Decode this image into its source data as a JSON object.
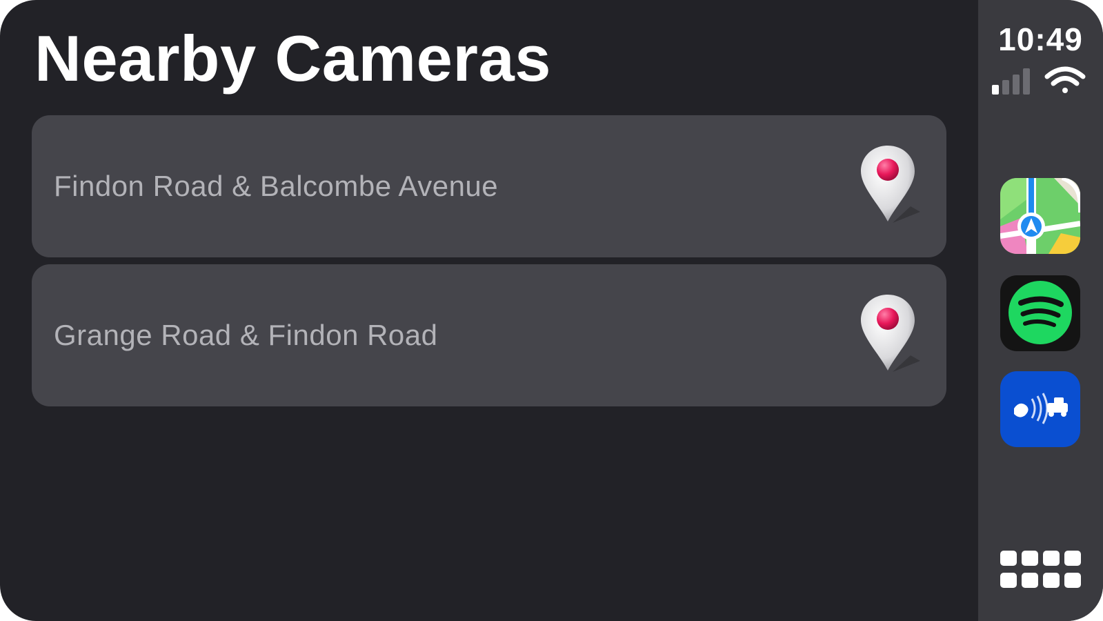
{
  "page": {
    "title": "Nearby Cameras"
  },
  "cameras": [
    {
      "label": "Findon Road & Balcombe Avenue",
      "icon": "map-pin-icon"
    },
    {
      "label": "Grange Road & Findon Road",
      "icon": "map-pin-icon"
    }
  ],
  "status_bar": {
    "time": "10:49",
    "cellular_icon": "cellular-signal-icon",
    "wifi_icon": "wifi-icon"
  },
  "dock": {
    "apps": [
      {
        "name": "Maps",
        "icon": "maps-app-icon",
        "color": "#5ec26a"
      },
      {
        "name": "Spotify",
        "icon": "spotify-app-icon",
        "color": "#1ed760"
      },
      {
        "name": "Speed Camera App",
        "icon": "speed-camera-app-icon",
        "color": "#0a4fd1"
      }
    ],
    "app_grid_icon": "app-grid-icon"
  },
  "colors": {
    "background": "#222227",
    "row_background": "#45454b",
    "sidebar_background": "#3a3a3f",
    "title_text": "#ffffff",
    "row_text": "#b3b3b8",
    "pin_head": "#e8185a"
  }
}
